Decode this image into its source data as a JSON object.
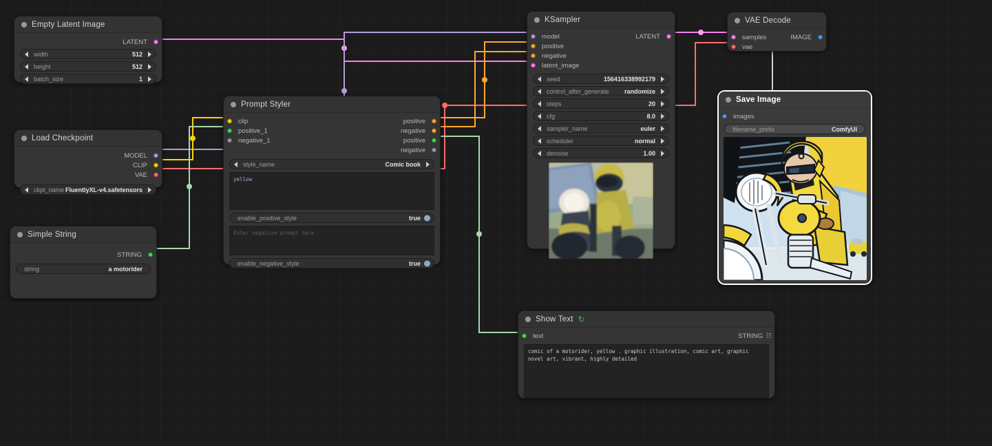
{
  "app": {
    "name": "ComfyUI",
    "canvas_bg": "#1b1b1b"
  },
  "colors": {
    "latent": "#ff7ff0",
    "model": "#b39ddb",
    "clip": "#ffd500",
    "vae": "#ff6e6e",
    "conditioning": "#ffa931",
    "string": "#a8d8b0",
    "image": "#4f9ef0"
  },
  "nodes": {
    "empty_latent": {
      "title": "Empty Latent Image",
      "outputs": [
        {
          "label": "LATENT",
          "color": "#ff7ff0"
        }
      ],
      "widgets": [
        {
          "name": "width",
          "value": "512"
        },
        {
          "name": "height",
          "value": "512"
        },
        {
          "name": "batch_size",
          "value": "1"
        }
      ]
    },
    "load_checkpoint": {
      "title": "Load Checkpoint",
      "outputs": [
        {
          "label": "MODEL",
          "color": "#b39ddb"
        },
        {
          "label": "CLIP",
          "color": "#ffd500"
        },
        {
          "label": "VAE",
          "color": "#ff6e6e"
        }
      ],
      "widgets": [
        {
          "name": "ckpt_name",
          "value": "FluentlyXL-v4.safetensors"
        }
      ]
    },
    "simple_string": {
      "title": "Simple String",
      "outputs": [
        {
          "label": "STRING",
          "color": "#3ddc50"
        }
      ],
      "widgets": [
        {
          "name": "string",
          "value": "a motorider"
        }
      ]
    },
    "prompt_styler": {
      "title": "Prompt Styler",
      "inputs": [
        {
          "label": "clip",
          "color": "#ffd500"
        },
        {
          "label": "positive_1",
          "color": "#3ddc50"
        },
        {
          "label": "negative_1",
          "color": "#9a9ab0"
        }
      ],
      "outputs": [
        {
          "label": "positive",
          "color": "#ffa931"
        },
        {
          "label": "negative",
          "color": "#ffa931"
        },
        {
          "label": "positive",
          "color": "#3ddc50"
        },
        {
          "label": "negative",
          "color": "#9a9ab0"
        }
      ],
      "style_widget": {
        "name": "style_name",
        "value": "Comic book"
      },
      "positive_prompt": "yellow",
      "enable_positive": {
        "name": "enable_positive_style",
        "value": "true"
      },
      "negative_prompt_placeholder": "Enter negative prompt here",
      "negative_prompt": "",
      "enable_negative": {
        "name": "enable_negative_style",
        "value": "true"
      }
    },
    "ksampler": {
      "title": "KSampler",
      "inputs": [
        {
          "label": "model",
          "color": "#b39ddb"
        },
        {
          "label": "positive",
          "color": "#ffa931"
        },
        {
          "label": "negative",
          "color": "#ffa931"
        },
        {
          "label": "latent_image",
          "color": "#ff7ff0"
        }
      ],
      "outputs": [
        {
          "label": "LATENT",
          "color": "#ff7ff0"
        }
      ],
      "widgets": [
        {
          "name": "seed",
          "value": "156416338992179"
        },
        {
          "name": "control_after_generate",
          "value": "randomize"
        },
        {
          "name": "steps",
          "value": "20"
        },
        {
          "name": "cfg",
          "value": "8.0"
        },
        {
          "name": "sampler_name",
          "value": "euler"
        },
        {
          "name": "scheduler",
          "value": "normal"
        },
        {
          "name": "denoise",
          "value": "1.00"
        }
      ],
      "preview_alt": "comic motorcycle rider preview"
    },
    "vae_decode": {
      "title": "VAE Decode",
      "inputs": [
        {
          "label": "samples",
          "color": "#ff7ff0"
        },
        {
          "label": "vae",
          "color": "#ff6e6e"
        }
      ],
      "outputs": [
        {
          "label": "IMAGE",
          "color": "#4f9ef0"
        }
      ]
    },
    "save_image": {
      "title": "Save Image",
      "inputs": [
        {
          "label": "images",
          "color": "#4f9ef0"
        }
      ],
      "widgets": [
        {
          "name": "filename_prefix",
          "value": "ComfyUI"
        }
      ],
      "preview_alt": "comic illustration of a motorcyclist in yellow gear"
    },
    "show_text": {
      "title": "Show Text",
      "title_icon": "refresh-icon",
      "inputs": [
        {
          "label": "text",
          "color": "#3ddc50"
        }
      ],
      "outputs": [
        {
          "label": "STRING",
          "color": "#a8d8b0"
        }
      ],
      "text_value": "comic of a motorider, yellow  . graphic illustration, comic art, graphic novel art, vibrant, highly detailed"
    }
  }
}
